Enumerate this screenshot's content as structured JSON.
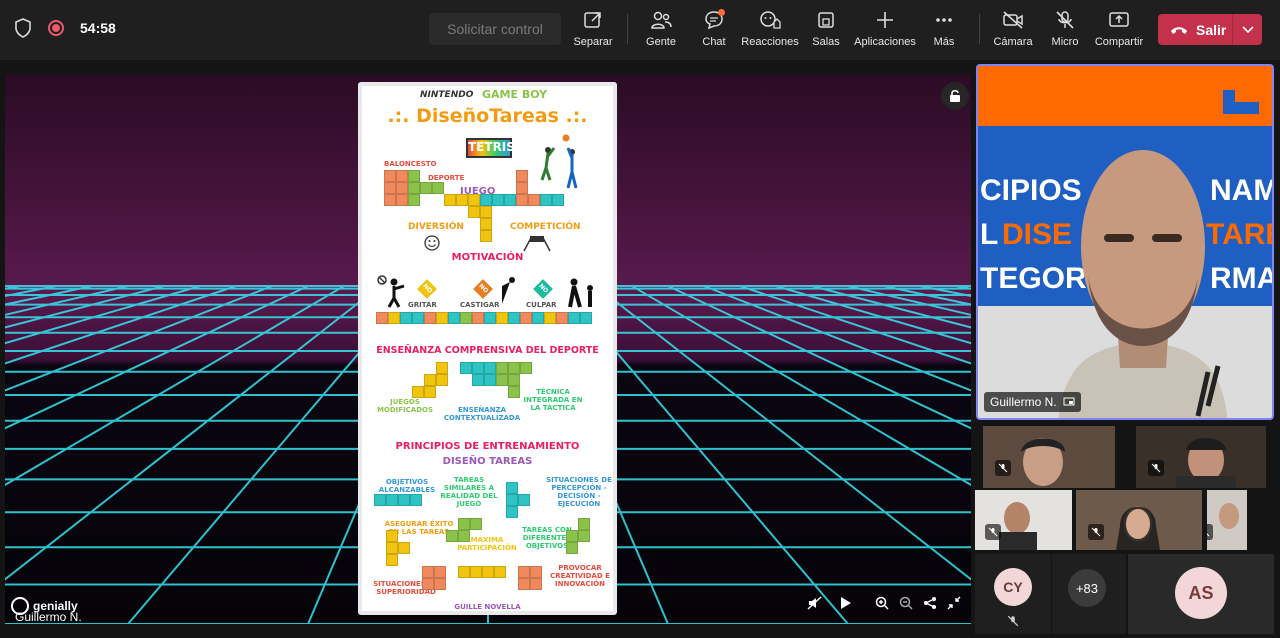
{
  "topbar": {
    "timer": "54:58",
    "request_control": "Solicitar control",
    "buttons": {
      "pop_out": "Separar",
      "people": "Gente",
      "chat": "Chat",
      "reactions": "Reacciones",
      "rooms": "Salas",
      "apps": "Aplicaciones",
      "more": "Más",
      "camera": "Cámara",
      "mic": "Micro",
      "share": "Compartir"
    },
    "leave": "Salir",
    "colors": {
      "leave": "#c4314b",
      "accent": "#7f85f5",
      "chat_badge": "#ff6a3d"
    }
  },
  "stage": {
    "presenter": "Guillermo N.",
    "watermark": "genially",
    "poster": {
      "brand_prefix": "NINTENDO",
      "brand": "GAME BOY",
      "title": ".:. DiseñoTareas .:.",
      "logo": "TETRIS",
      "words": {
        "baloncesto": "BALONCESTO",
        "deporte": "DEPORTE",
        "juego": "JUEGO",
        "diversion": "DIVERSIÓN",
        "competicion": "COMPETICIÓN",
        "motivacion": "MOTIVACIÓN",
        "no1": "NO",
        "no2": "NO",
        "no3": "NO",
        "gritar": "GRITAR",
        "castigar": "CASTIGAR",
        "culpar": "CULPAR",
        "ecd": "ENSEÑANZA COMPRENSIVA DEL DEPORTE",
        "juegos_mod": "JUEGOS MODIFICADOS",
        "ens_ctx": "ENSEÑANZA CONTEXTUALIZADA",
        "tecnica": "TÉCNICA INTEGRADA EN LA TÁCTICA",
        "principios": "PRINCIPIOS DE ENTRENAMIENTO",
        "diseno_tareas": "DISEÑO TAREAS",
        "objetivos": "OBJETIVOS ALCANZABLES",
        "similares": "TAREAS SIMILARES A REALIDAD DEL JUEGO",
        "situaciones": "SITUACIONES DE PERCEPCIÓN - DECISIÓN - EJECUCIÓN",
        "asegurar": "ASEGURAR ÉXITO EN LAS TAREAS",
        "maxima": "MÁXIMA PARTICIPACIÓN",
        "diferentes": "TAREAS CON DIFERENTES OBJETIVOS",
        "superioridad": "SITUACIONES DE SUPERIORIDAD",
        "provocar": "PROVOCAR CREATIVIDAD E INNOVACIÓN",
        "author": "GUILLE NOVELLA"
      }
    }
  },
  "participants": {
    "main": {
      "name": "Guillermo N.",
      "background_words": [
        "CIPIOS",
        "NAMI",
        "L",
        "DISE",
        "TARE",
        "TEGORÍ",
        "RMAC"
      ]
    },
    "avatar_cy": "CY",
    "overflow": "+83",
    "avatar_as": "AS"
  }
}
